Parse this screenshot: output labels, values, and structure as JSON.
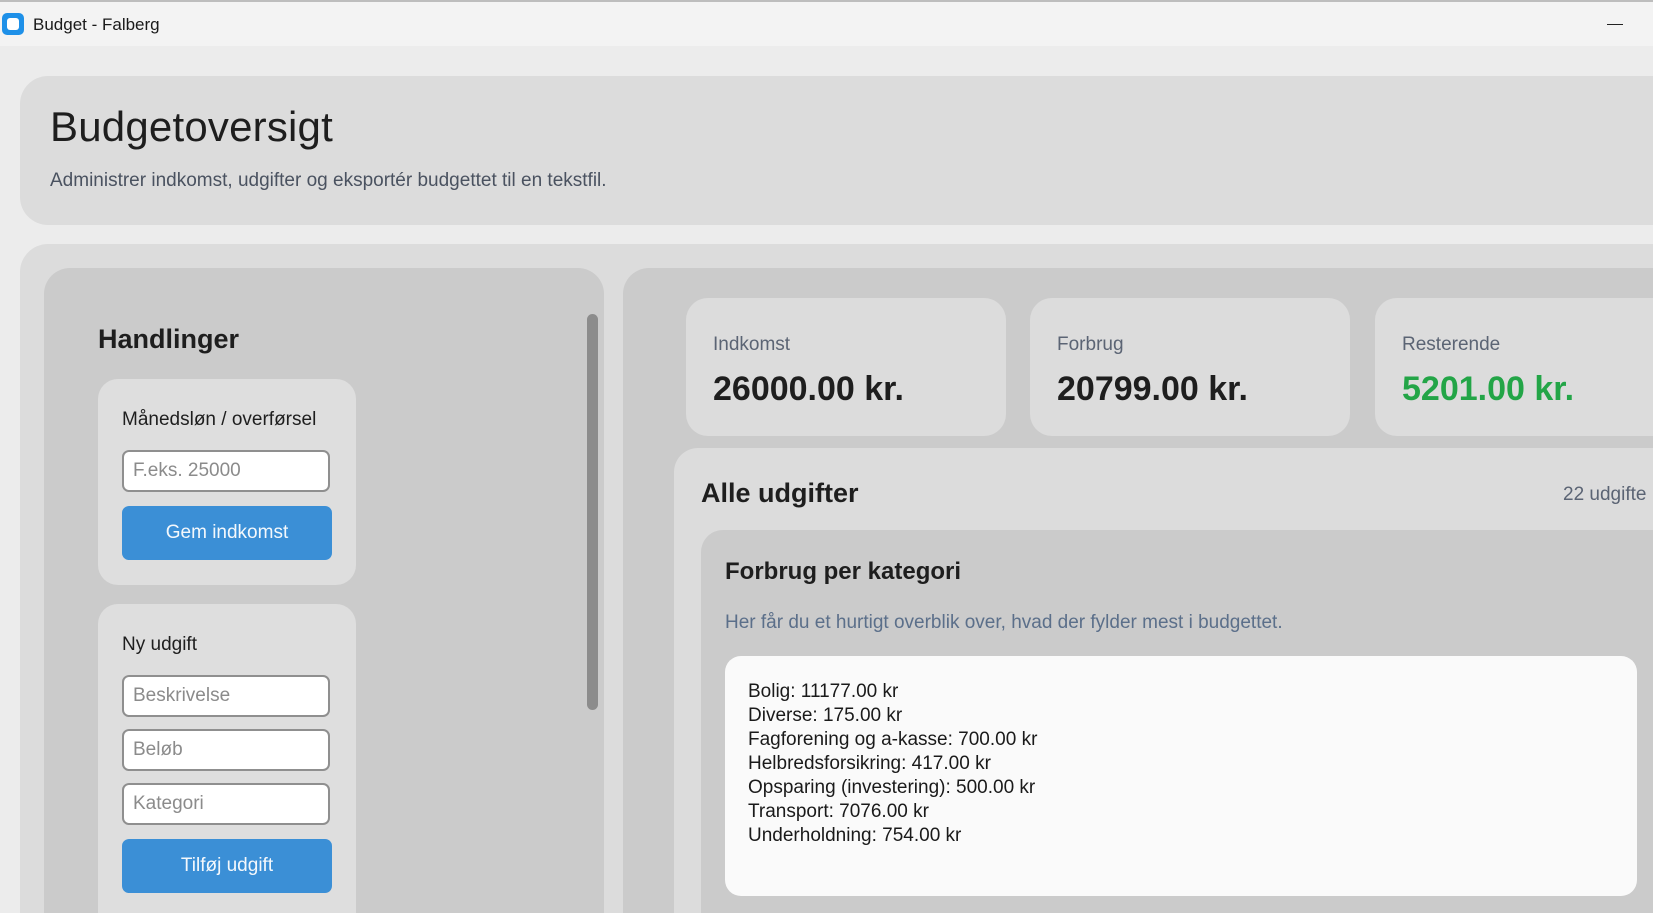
{
  "window": {
    "title": "Budget - Falberg",
    "icon": "app-icon"
  },
  "header": {
    "title": "Budgetoversigt",
    "subtitle": "Administrer indkomst, udgifter og eksportér budgettet til en tekstfil."
  },
  "actions": {
    "title": "Handlinger",
    "income": {
      "label": "Månedsløn / overførsel",
      "placeholder": "F.eks. 25000",
      "value": "",
      "button": "Gem indkomst"
    },
    "expense": {
      "label": "Ny udgift",
      "description_placeholder": "Beskrivelse",
      "amount_placeholder": "Beløb",
      "category_placeholder": "Kategori",
      "button": "Tilføj udgift"
    }
  },
  "summary": [
    {
      "label": "Indkomst",
      "value": "26000.00 kr.",
      "color": "#1e1e1e"
    },
    {
      "label": "Forbrug",
      "value": "20799.00 kr.",
      "color": "#1e1e1e"
    },
    {
      "label": "Resterende",
      "value": "5201.00 kr.",
      "color": "#23a547"
    }
  ],
  "expenses": {
    "title": "Alle udgifter",
    "count": "22 udgifte",
    "category_section": {
      "title": "Forbrug per kategori",
      "description": "Her får du et hurtigt overblik over, hvad der fylder mest i budgettet.",
      "items": [
        "Bolig: 11177.00 kr",
        "Diverse: 175.00 kr",
        "Fagforening og a-kasse: 700.00 kr",
        "Helbredsforsikring: 417.00 kr",
        "Opsparing (investering): 500.00 kr",
        "Transport: 7076.00 kr",
        "Underholdning: 754.00 kr"
      ]
    }
  },
  "colors": {
    "accent": "#3b8fd6",
    "positive": "#23a547",
    "muted_text": "#5b6474"
  }
}
